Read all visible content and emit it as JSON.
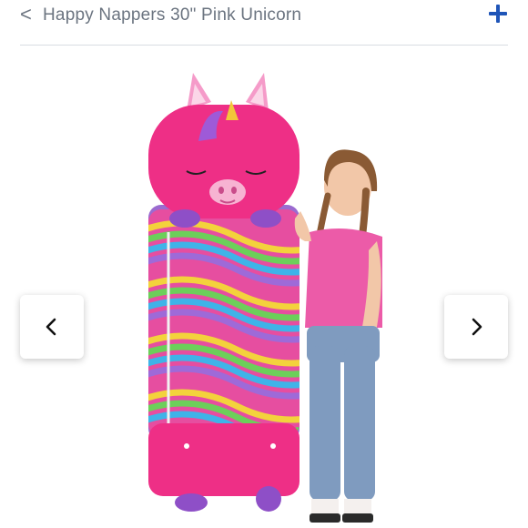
{
  "header": {
    "back_label": "<",
    "title": "Happy Nappers 30\" Pink Unicorn",
    "plus_icon": "plus-icon",
    "accent_color": "#1f55b8"
  },
  "gallery": {
    "prev_icon": "chevron-left-icon",
    "next_icon": "chevron-right-icon"
  }
}
